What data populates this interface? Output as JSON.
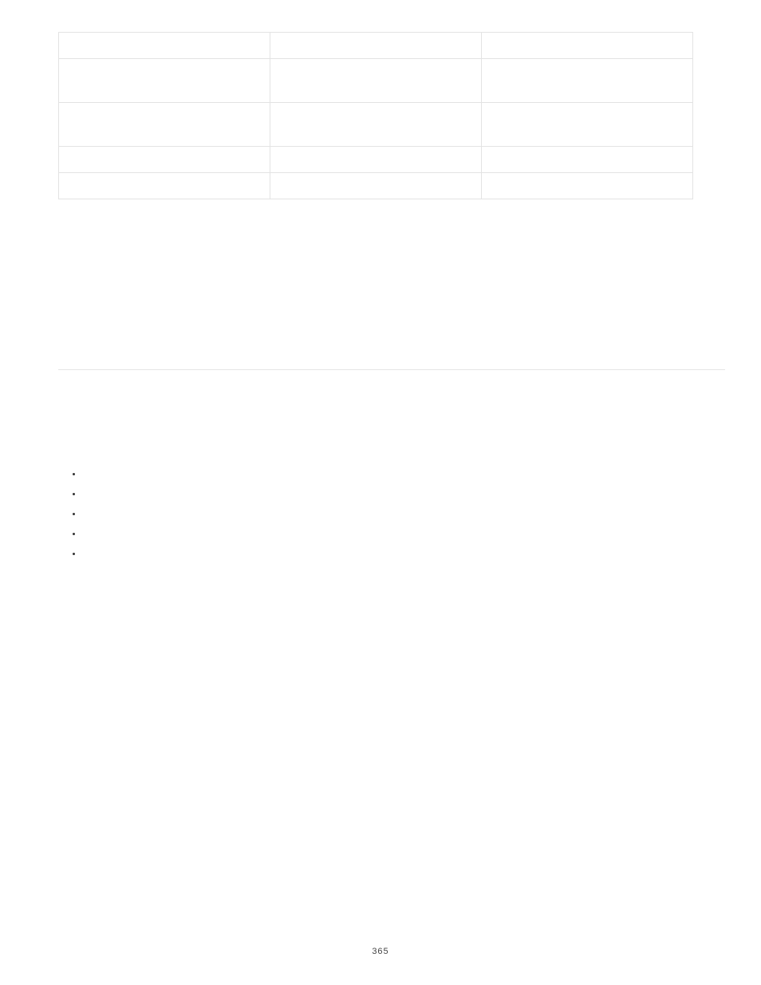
{
  "page_number": "365",
  "table": {
    "columns": 3,
    "rows": [
      {
        "height_class": "row-h-small",
        "cells": [
          "",
          "",
          ""
        ]
      },
      {
        "height_class": "row-h-med",
        "cells": [
          "",
          "",
          ""
        ]
      },
      {
        "height_class": "row-h-med2",
        "cells": [
          "",
          "",
          ""
        ]
      },
      {
        "height_class": "row-h-small",
        "cells": [
          "",
          "",
          ""
        ]
      },
      {
        "height_class": "row-h-small",
        "cells": [
          "",
          "",
          ""
        ]
      }
    ]
  },
  "bullets": [
    "",
    "",
    "",
    "",
    ""
  ]
}
